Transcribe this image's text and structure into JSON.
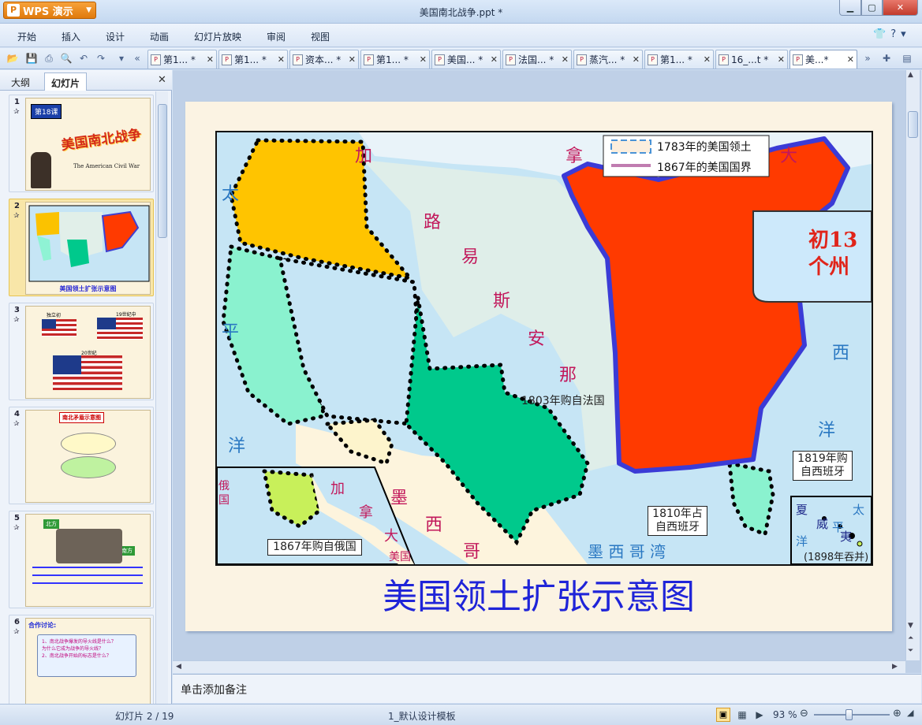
{
  "app": {
    "name": "WPS 演示",
    "window_title": "美国南北战争.ppt *"
  },
  "menu": [
    "开始",
    "插入",
    "设计",
    "动画",
    "幻灯片放映",
    "审阅",
    "视图"
  ],
  "doc_tabs": [
    {
      "label": "第1... *",
      "active": false
    },
    {
      "label": "第1... *",
      "active": false
    },
    {
      "label": "资本... *",
      "active": false
    },
    {
      "label": "第1... *",
      "active": false
    },
    {
      "label": "美国... *",
      "active": false
    },
    {
      "label": "法国... *",
      "active": false
    },
    {
      "label": "蒸汽... *",
      "active": false
    },
    {
      "label": "第1... *",
      "active": false
    },
    {
      "label": "16_...t *",
      "active": false
    },
    {
      "label": "美...*",
      "active": true
    }
  ],
  "panel": {
    "tab_outline": "大纲",
    "tab_slides": "幻灯片"
  },
  "thumbnails": [
    {
      "num": "1",
      "title": "美国南北战争",
      "badge": "第18课",
      "subtitle": "The American Civil War"
    },
    {
      "num": "2",
      "caption": "美国领土扩张示意图"
    },
    {
      "num": "3",
      "labels": [
        "独立初",
        "19世纪中",
        "20世纪"
      ]
    },
    {
      "num": "4",
      "title": "南北矛盾示意图"
    },
    {
      "num": "5",
      "labels": [
        "北方",
        "南方"
      ]
    },
    {
      "num": "6",
      "title": "合作讨论:",
      "items": [
        "1、南北战争爆发的导火线是什么？",
        "为什么它成为战争的导火线？",
        "2、南北战争开始的标志是什么？"
      ]
    }
  ],
  "slide": {
    "title": "美国领土扩张示意图",
    "legend": {
      "item1": "1783年的美国领土",
      "item2": "1867年的美国国界"
    },
    "labels": {
      "canada1": "加",
      "canada2": "拿",
      "canada3": "大",
      "louisiana": [
        "路",
        "易",
        "斯",
        "安",
        "那"
      ],
      "purchase_france": "1803年购自法国",
      "pacific1": "太",
      "pacific2": "平",
      "pacific3": "洋",
      "atlantic": "西",
      "atlantic2": "洋",
      "mexico1": "墨",
      "mexico2": "西",
      "mexico3": "哥",
      "gulf": "墨  西  哥  湾",
      "florida": "1819年购\n自西班牙",
      "west_florida": "1810年占\n自西班牙",
      "alaska_label": "1867年购自俄国",
      "russia": "俄\n国",
      "inset_canada": [
        "加",
        "拿",
        "大"
      ],
      "inset_us": "美国",
      "hawaii": [
        "夏",
        "威",
        "夷"
      ],
      "hawaii_year": "(1898年吞并)",
      "hawaii_ocean": [
        "太",
        "平",
        "洋"
      ],
      "callout": "初13\n个州"
    }
  },
  "notes_placeholder": "单击添加备注",
  "status": {
    "slide_info": "幻灯片 2 / 19",
    "template": "1_默认设计模板",
    "zoom": "93 %"
  }
}
